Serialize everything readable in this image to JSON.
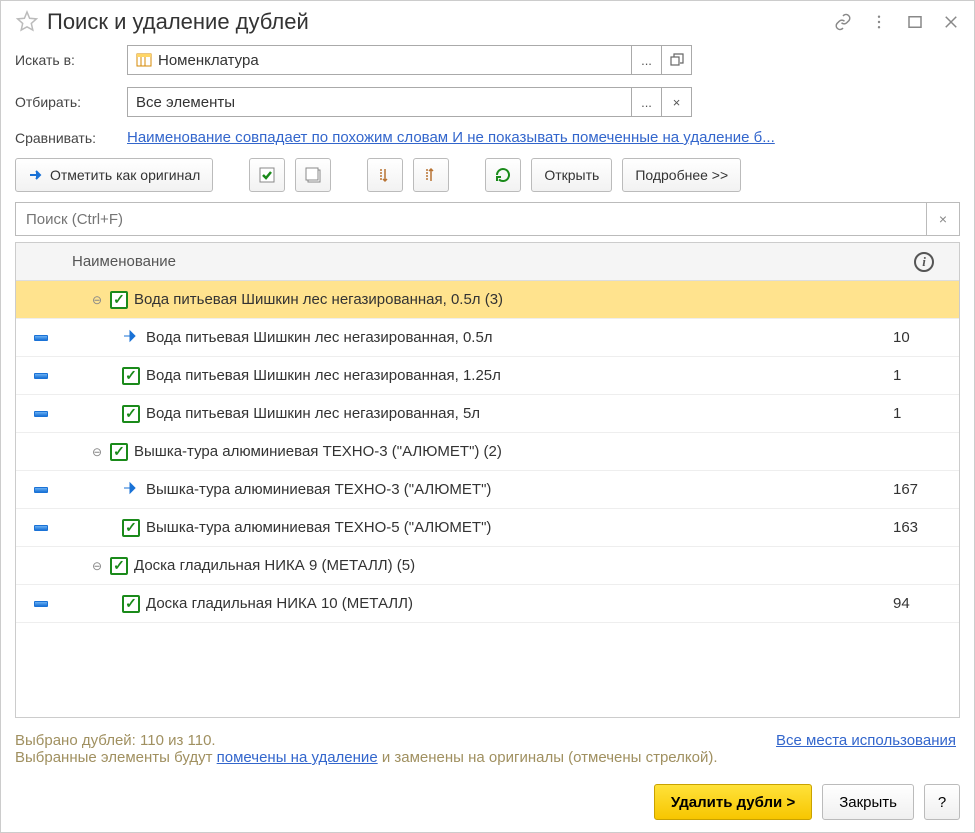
{
  "title": "Поиск и удаление дублей",
  "labels": {
    "searchIn": "Искать в:",
    "filter": "Отбирать:",
    "compare": "Сравнивать:"
  },
  "fields": {
    "searchIn": "Номенклатура",
    "filter": "Все элементы",
    "ellipsis": "...",
    "compareLink": "Наименование совпадает по похожим словам И не показывать помеченные на удаление б..."
  },
  "toolbar": {
    "markOriginal": "Отметить как оригинал",
    "open": "Открыть",
    "more": "Подробнее >>"
  },
  "search": {
    "placeholder": "Поиск (Ctrl+F)",
    "clear": "×"
  },
  "table": {
    "headerName": "Наименование",
    "rows": [
      {
        "type": "group",
        "selected": true,
        "expand": "⊖",
        "checked": true,
        "text": "Вода питьевая Шишкин лес негазированная, 0.5л (3)",
        "val": ""
      },
      {
        "type": "child",
        "mark": "minus",
        "original": true,
        "text": "Вода питьевая Шишкин лес негазированная, 0.5л",
        "val": "10"
      },
      {
        "type": "child",
        "mark": "minus",
        "checked": true,
        "text": "Вода питьевая Шишкин лес негазированная, 1.25л",
        "val": "1"
      },
      {
        "type": "child",
        "mark": "minus",
        "checked": true,
        "text": "Вода питьевая Шишкин лес негазированная, 5л",
        "val": "1"
      },
      {
        "type": "group",
        "expand": "⊖",
        "checked": true,
        "text": "Вышка-тура алюминиевая ТЕХНО-3 (\"АЛЮМЕТ\") (2)",
        "val": ""
      },
      {
        "type": "child",
        "mark": "minus",
        "original": true,
        "text": "Вышка-тура алюминиевая ТЕХНО-3 (\"АЛЮМЕТ\")",
        "val": "167"
      },
      {
        "type": "child",
        "mark": "minus",
        "checked": true,
        "text": "Вышка-тура алюминиевая ТЕХНО-5 (\"АЛЮМЕТ\")",
        "val": "163"
      },
      {
        "type": "group",
        "expand": "⊖",
        "checked": true,
        "text": "Доска гладильная  НИКА 9 (МЕТАЛЛ) (5)",
        "val": ""
      },
      {
        "type": "child",
        "mark": "minus",
        "checked": true,
        "text": "Доска гладильная  НИКА 10 (МЕТАЛЛ)",
        "val": "94"
      }
    ]
  },
  "footer": {
    "selected": "Выбрано дублей: 110 из 110.",
    "desc1": "Выбранные элементы будут ",
    "descLink": "помечены на удаление",
    "desc2": " и заменены на оригиналы (отмечены стрелкой).",
    "rightLink": "Все места использования",
    "delete": "Удалить дубли >",
    "close": "Закрыть",
    "help": "?"
  },
  "icons": {
    "clear": "×",
    "expand": "⊡",
    "check": "✓",
    "info": "i"
  }
}
